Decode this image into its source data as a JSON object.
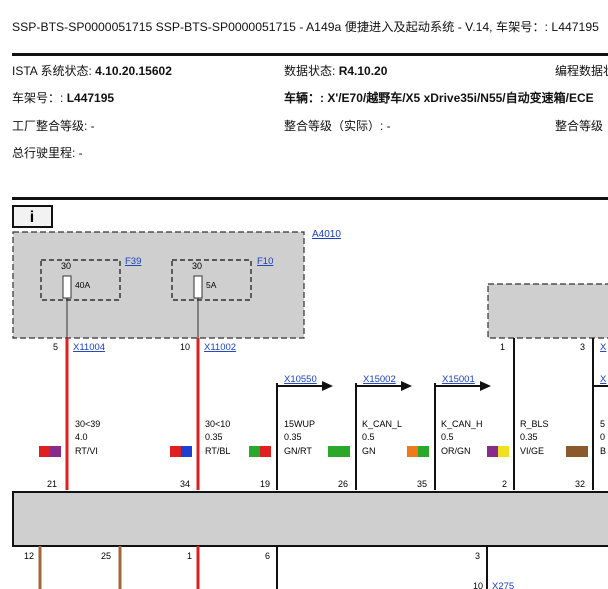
{
  "title": "SSP-BTS-SP0000051715 SSP-BTS-SP0000051715 - A149a 便捷进入及起动系统 - V.14, 车架号：: L447195",
  "info": {
    "ista_label": "ISTA 系统状态:",
    "ista_value": "4.10.20.15602",
    "data_label": "数据状态:",
    "data_value": "R4.10.20",
    "prog_label": "编程数据状态:",
    "vin_label": "车架号：:",
    "vin_value": "L447195",
    "vehicle_label": "车辆：:",
    "vehicle_value": "X'/E70/越野车/X5 xDrive35i/N55/自动变速箱/ECE",
    "factory_label": "工厂整合等级: -",
    "integ_label": "整合等级（实际）: -",
    "integ2_label": "整合等级",
    "mileage_label": "总行驶里程: -"
  },
  "diagram": {
    "info_icon": "i",
    "module_a": "A4010",
    "fuses": [
      {
        "id": "F39",
        "pin": "30",
        "rating": "40A"
      },
      {
        "id": "F10",
        "pin": "30",
        "rating": "5A"
      }
    ],
    "top_pins": [
      {
        "pin": "5",
        "conn": "X11004"
      },
      {
        "pin": "10",
        "conn": "X11002"
      },
      {
        "pin": "1",
        "conn": ""
      },
      {
        "pin": "3",
        "conn": "X"
      }
    ],
    "connectors": [
      "X10550",
      "X15002",
      "X15001",
      "X"
    ],
    "wires": [
      {
        "signal": "30<39",
        "size": "4.0",
        "color": "RT/VI",
        "pin": "21",
        "c1": "#e02020",
        "c2": "#8a2a8a"
      },
      {
        "signal": "30<10",
        "size": "0.35",
        "color": "RT/BL",
        "pin": "34",
        "c1": "#e02020",
        "c2": "#1f3fd0"
      },
      {
        "signal": "15WUP",
        "size": "0.35",
        "color": "GN/RT",
        "pin": "19",
        "c1": "#2aa82a",
        "c2": "#e02020"
      },
      {
        "signal": "K_CAN_L",
        "size": "0.5",
        "color": "GN",
        "pin": "26",
        "c1": "#2aa82a",
        "c2": "#2aa82a"
      },
      {
        "signal": "K_CAN_H",
        "size": "0.5",
        "color": "OR/GN",
        "pin": "35",
        "c1": "#f07a1a",
        "c2": "#2aa82a"
      },
      {
        "signal": "R_BLS",
        "size": "0.35",
        "color": "VI/GE",
        "pin": "2",
        "c1": "#8a2a8a",
        "c2": "#f0e020"
      },
      {
        "signal": "5",
        "size": "0",
        "color": "B",
        "pin": "32",
        "c1": "#8b5a2b",
        "c2": "#8b5a2b"
      }
    ],
    "bottom_pins": [
      "12",
      "25",
      "1",
      "6",
      "3"
    ],
    "bottom_conn": "X275",
    "bottom_pin2": "10"
  },
  "colors": {
    "red": "#e02020",
    "brown": "#a0673a",
    "box": "#cfcfcf",
    "link": "#1a3fc4"
  }
}
